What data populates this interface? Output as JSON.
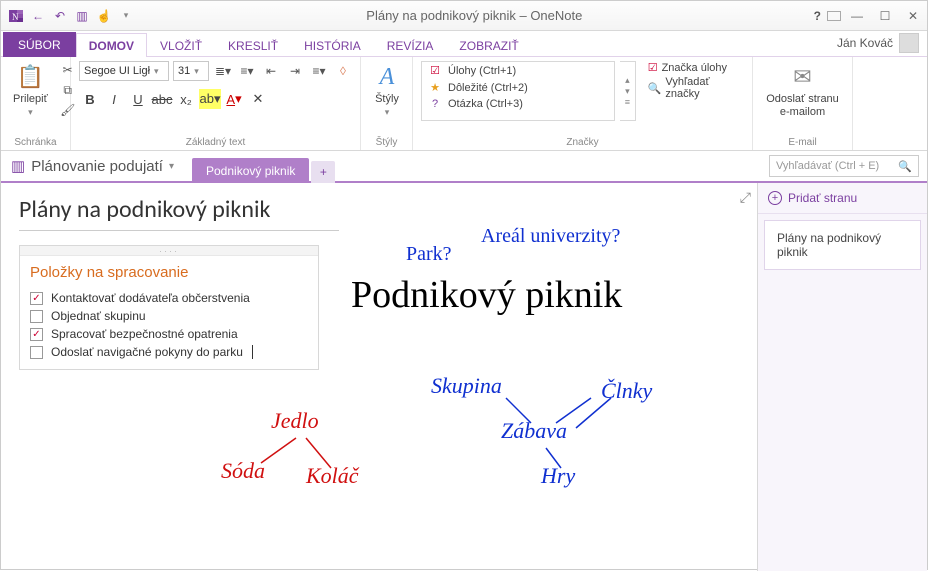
{
  "window": {
    "title": "Plány na podnikový piknik – OneNote"
  },
  "user": {
    "name": "Ján Kováč"
  },
  "ribbon_tabs": {
    "file": "SÚBOR",
    "items": [
      "DOMOV",
      "VLOŽIŤ",
      "KRESLIŤ",
      "HISTÓRIA",
      "REVÍZIA",
      "ZOBRAZIŤ"
    ],
    "active_index": 0
  },
  "ribbon": {
    "clipboard": {
      "paste": "Prilepiť",
      "group": "Schránka"
    },
    "font": {
      "name": "Segoe UI Ligł",
      "size": "31",
      "group": "Základný text"
    },
    "styles": {
      "label": "Štýly",
      "group": "Štýly"
    },
    "tags": {
      "group": "Značky",
      "list": [
        {
          "icon": "☑",
          "label": "Úlohy (Ctrl+1)"
        },
        {
          "icon": "★",
          "label": "Dôležité (Ctrl+2)"
        },
        {
          "icon": "?",
          "label": "Otázka (Ctrl+3)"
        }
      ],
      "todo_tag": "Značka úlohy",
      "find_tags": "Vyhľadať značky"
    },
    "email": {
      "label": "Odoslať stranu e-mailom",
      "group": "E-mail"
    }
  },
  "notebook": {
    "name": "Plánovanie podujatí",
    "section": "Podnikový piknik",
    "search_placeholder": "Vyhľadávať (Ctrl + E)"
  },
  "page": {
    "title": "Plány na podnikový piknik",
    "outline_title": "Položky na spracovanie",
    "todos": [
      {
        "checked": true,
        "text": "Kontaktovať dodávateľa občerstvenia"
      },
      {
        "checked": false,
        "text": "Objednať skupinu"
      },
      {
        "checked": true,
        "text": "Spracovať bezpečnostné opatrenia"
      },
      {
        "checked": false,
        "text": "Odoslať navigačné pokyny do parku"
      }
    ],
    "ink": {
      "park": "Park?",
      "areal": "Areál univerzity?",
      "heading": "Podnikový piknik",
      "skupina": "Skupina",
      "clnky": "Člnky",
      "zabava": "Zábava",
      "hry": "Hry",
      "jedlo": "Jedlo",
      "soda": "Sóda",
      "kolac": "Koláč"
    }
  },
  "pages_pane": {
    "add": "Pridať stranu",
    "items": [
      "Plány na podnikový piknik"
    ]
  }
}
